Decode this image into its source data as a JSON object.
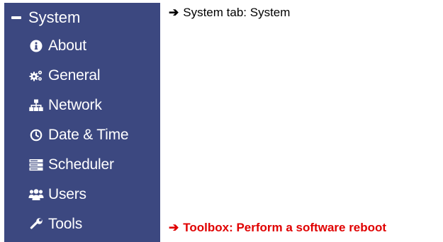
{
  "sidebar": {
    "header": {
      "label": "System",
      "icon": "minus-icon"
    },
    "items": [
      {
        "label": "About",
        "icon": "info-circle-icon"
      },
      {
        "label": "General",
        "icon": "cogs-icon"
      },
      {
        "label": "Network",
        "icon": "sitemap-icon"
      },
      {
        "label": "Date & Time",
        "icon": "clock-icon"
      },
      {
        "label": "Scheduler",
        "icon": "server-icon"
      },
      {
        "label": "Users",
        "icon": "users-icon"
      },
      {
        "label": "Tools",
        "icon": "wrench-icon"
      }
    ],
    "colors": {
      "background": "#3c4880",
      "text": "#ffffff"
    }
  },
  "annotations": {
    "system_tab": "System tab: System",
    "toolbox": "Toolbox: Perform a software reboot",
    "colors": {
      "system_tab": "#000000",
      "toolbox": "#e00000"
    }
  }
}
